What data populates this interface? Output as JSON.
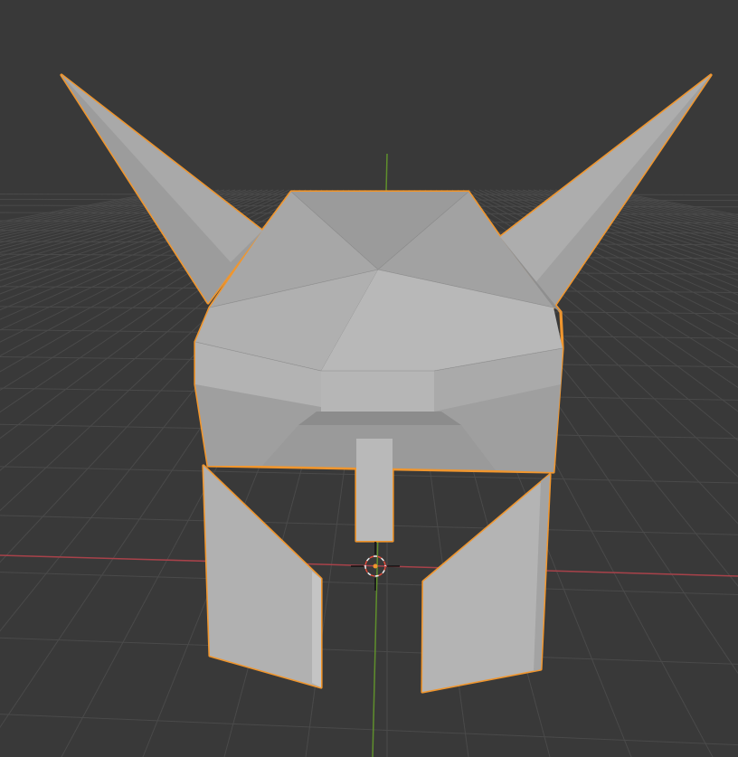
{
  "viewport": {
    "background_color": "#393939",
    "grid_line_color": "#4a4a4a",
    "x_axis_color": "#a8424a",
    "y_axis_color": "#5f8f2c",
    "selection_outline_color": "#f0962e",
    "mesh_base_color": "#a6a6a6"
  },
  "scene": {
    "selected_object_icon": "helmet-mesh",
    "cursor_icon": "3d-cursor-icon",
    "origin_icon": "object-origin-icon"
  }
}
